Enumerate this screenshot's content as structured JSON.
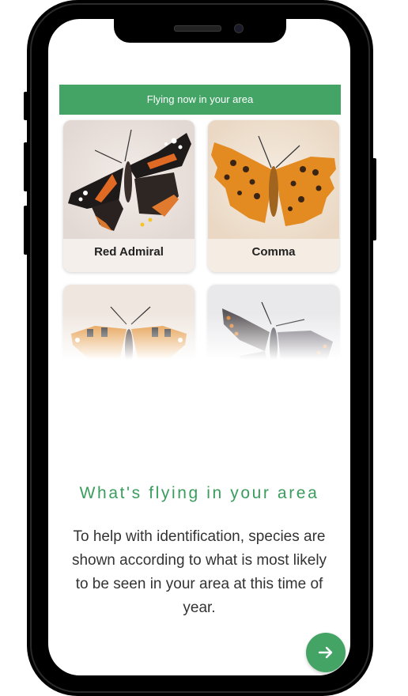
{
  "banner": {
    "text": "Flying now in your area"
  },
  "species": [
    {
      "name": "Red Admiral"
    },
    {
      "name": "Comma"
    },
    {
      "name": ""
    },
    {
      "name": ""
    }
  ],
  "headline": "What's flying in your area",
  "description": "To help with identification, species are shown according to what is most likely to be seen in your area at this time of year.",
  "next_button": {
    "icon": "arrow-right-icon"
  },
  "colors": {
    "accent": "#43a466",
    "headline": "#3a9d5d",
    "frame": "#000000"
  }
}
